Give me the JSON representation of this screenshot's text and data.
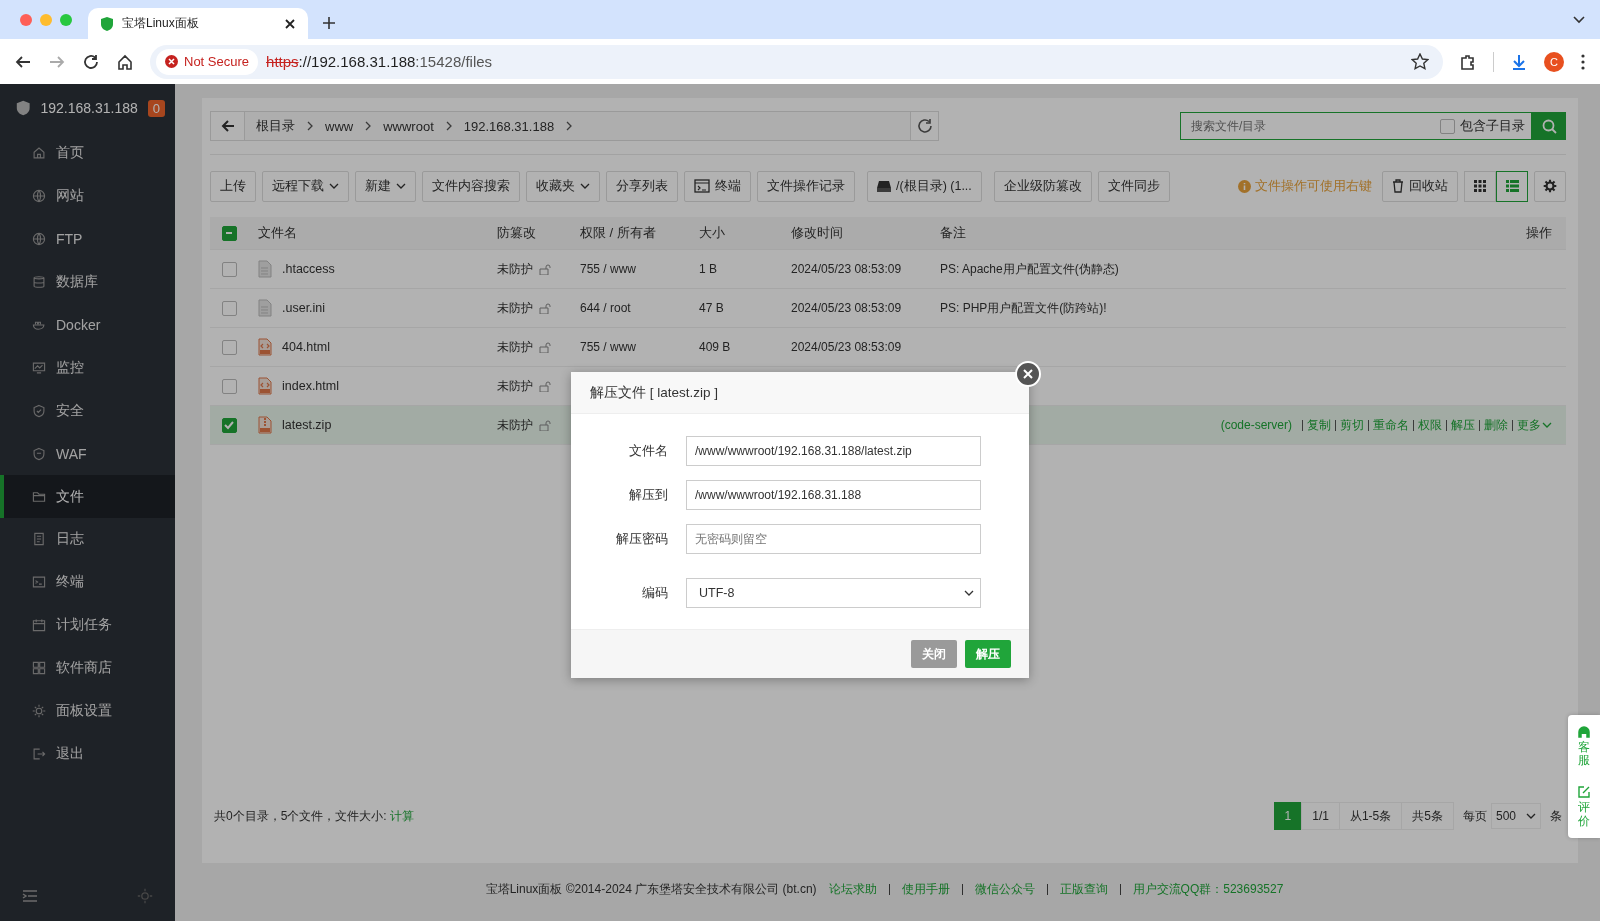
{
  "browser": {
    "tab_title": "宝塔Linux面板",
    "security": "Not Secure",
    "url_scheme": "https",
    "url_host": "://192.168.31.188",
    "url_path": ":15428/files",
    "profile_initial": "C"
  },
  "sidebar": {
    "host": "192.168.31.188",
    "badge": "0",
    "items": [
      {
        "label": "首页",
        "selected": false
      },
      {
        "label": "网站",
        "selected": false
      },
      {
        "label": "FTP",
        "selected": false
      },
      {
        "label": "数据库",
        "selected": false
      },
      {
        "label": "Docker",
        "selected": false
      },
      {
        "label": "监控",
        "selected": false
      },
      {
        "label": "安全",
        "selected": false
      },
      {
        "label": "WAF",
        "selected": false
      },
      {
        "label": "文件",
        "selected": true
      },
      {
        "label": "日志",
        "selected": false
      },
      {
        "label": "终端",
        "selected": false
      },
      {
        "label": "计划任务",
        "selected": false
      },
      {
        "label": "软件商店",
        "selected": false
      },
      {
        "label": "面板设置",
        "selected": false
      },
      {
        "label": "退出",
        "selected": false
      }
    ]
  },
  "file_manager": {
    "breadcrumb": [
      "根目录",
      "www",
      "wwwroot",
      "192.168.31.188"
    ],
    "search": {
      "placeholder": "搜索文件/目录",
      "include_subdirs": {
        "label": "包含子目录",
        "checked": false
      }
    },
    "toolbar": [
      {
        "label": "上传",
        "kind": "plain"
      },
      {
        "label": "远程下载",
        "kind": "dropdown"
      },
      {
        "label": "新建",
        "kind": "dropdown"
      },
      {
        "label": "文件内容搜索",
        "kind": "plain"
      },
      {
        "label": "收藏夹",
        "kind": "dropdown"
      },
      {
        "label": "分享列表",
        "kind": "plain"
      },
      {
        "label": "终端",
        "kind": "terminal"
      },
      {
        "label": "文件操作记录",
        "kind": "plain"
      },
      {
        "label": "/(根目录) (1...",
        "kind": "disk"
      },
      {
        "label": "企业级防篡改",
        "kind": "plain"
      },
      {
        "label": "文件同步",
        "kind": "plain"
      }
    ],
    "hint": "文件操作可使用右键",
    "recycle_bin": "回收站",
    "views": [
      {
        "kind": "grid",
        "selected": false
      },
      {
        "kind": "list",
        "selected": true
      }
    ],
    "table": {
      "select_all_partial": true,
      "columns": [
        "文件名",
        "防篡改",
        "权限 / 所有者",
        "大小",
        "修改时间",
        "备注",
        "操作"
      ],
      "rows": [
        {
          "name": ".htaccess",
          "kind": "text",
          "checked": false,
          "tamper": "未防护",
          "permission": "755 / www",
          "size": "1 B",
          "modified": "2024/05/23 08:53:09",
          "note": "PS: Apache用户配置文件(伪静态)"
        },
        {
          "name": ".user.ini",
          "kind": "text",
          "checked": false,
          "tamper": "未防护",
          "permission": "644 / root",
          "size": "47 B",
          "modified": "2024/05/23 08:53:09",
          "note": "PS: PHP用户配置文件(防跨站)!"
        },
        {
          "name": "404.html",
          "kind": "html",
          "checked": false,
          "tamper": "未防护",
          "permission": "755 / www",
          "size": "409 B",
          "modified": "2024/05/23 08:53:09"
        },
        {
          "name": "index.html",
          "kind": "html",
          "checked": false,
          "tamper": "未防护"
        },
        {
          "name": "latest.zip",
          "kind": "zip",
          "checked": true,
          "tamper": "未防护",
          "tag": "(code-server)",
          "actions": [
            "复制",
            "剪切",
            "重命名",
            "权限",
            "解压",
            "删除",
            "更多"
          ]
        }
      ]
    },
    "summary": {
      "text": "共0个目录，5个文件，文件大小: ",
      "link": "计算"
    },
    "pagination": {
      "pages": [
        {
          "label": "1",
          "selected": true
        }
      ],
      "page_info": "1/1",
      "range": "从1-5条",
      "total": "共5条",
      "per_page_label": "每页",
      "per_page": "500",
      "unit": "条"
    }
  },
  "dialog": {
    "title": "解压文件 [ latest.zip ]",
    "fields": [
      {
        "label": "文件名",
        "kind": "input",
        "value": "/www/wwwroot/192.168.31.188/latest.zip"
      },
      {
        "label": "解压到",
        "kind": "input",
        "value": "/www/wwwroot/192.168.31.188"
      },
      {
        "label": "解压密码",
        "kind": "input",
        "placeholder": "无密码则留空"
      },
      {
        "label": "编码",
        "kind": "select",
        "value": "UTF-8"
      }
    ],
    "buttons": [
      {
        "label": "关闭",
        "kind": "secondary"
      },
      {
        "label": "解压",
        "kind": "primary"
      }
    ]
  },
  "side_widget": [
    {
      "label": "客服",
      "kind": "service"
    },
    {
      "label": "评价",
      "kind": "review"
    }
  ],
  "footer": {
    "text": "宝塔Linux面板 ©2014-2024 广东堡塔安全技术有限公司 (bt.cn)",
    "links": [
      "论坛求助",
      "使用手册",
      "微信公众号",
      "正版查询",
      "用户交流QQ群：523693527"
    ]
  }
}
